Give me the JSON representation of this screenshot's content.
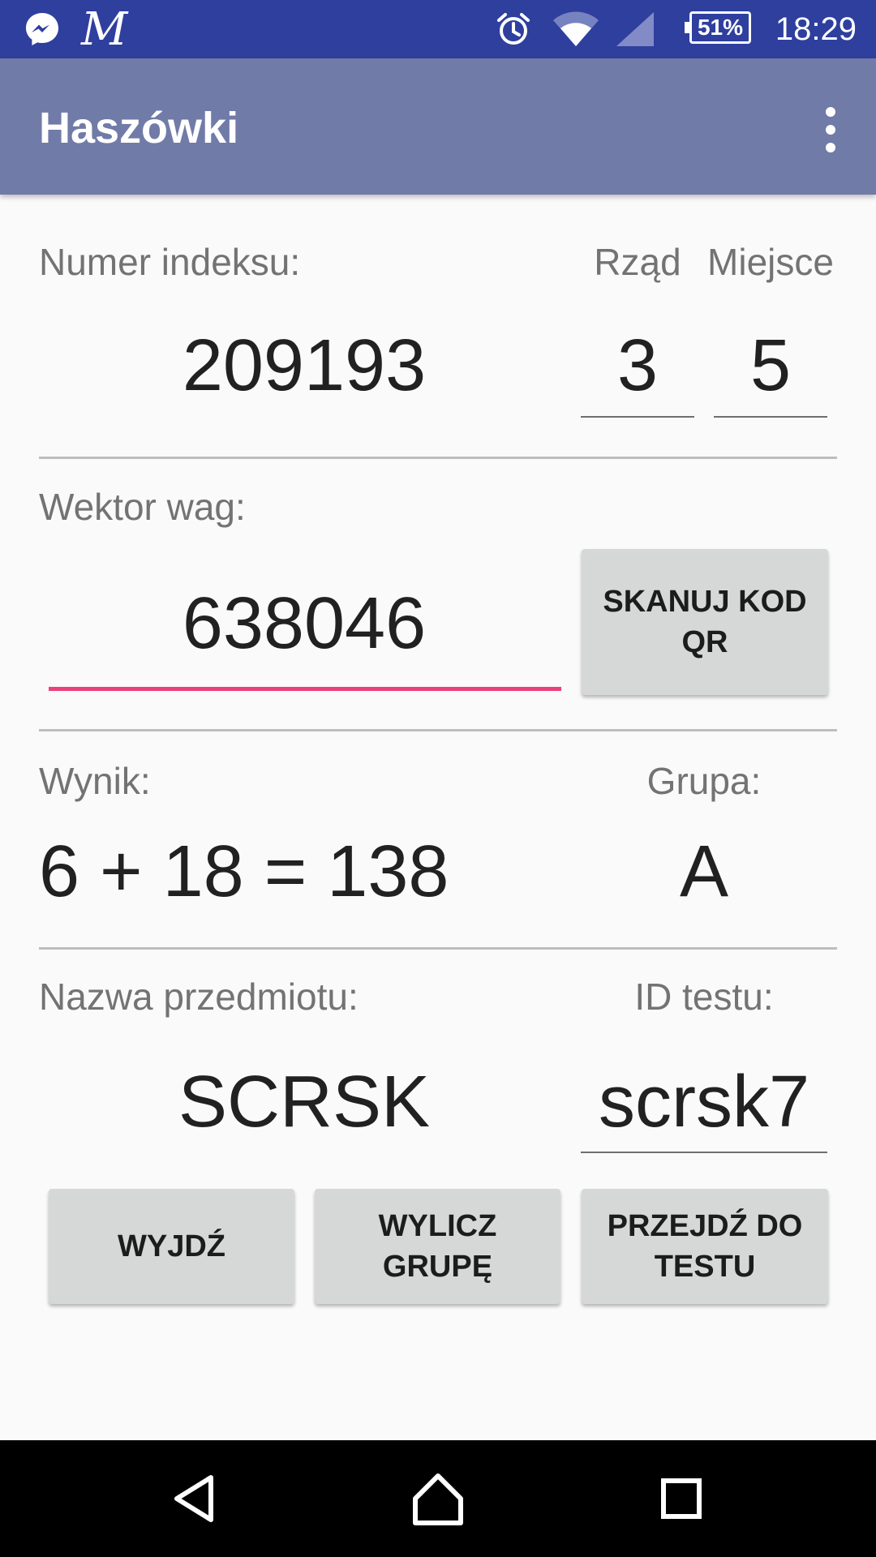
{
  "status_bar": {
    "time": "18:29",
    "battery": "51%",
    "app_icon_letter": "M",
    "icons": [
      "messenger-icon",
      "alarm-icon",
      "wifi-icon",
      "signal-icon",
      "battery-icon"
    ]
  },
  "app_bar": {
    "title": "Haszówki",
    "overflow_icon": "more-vert-icon"
  },
  "student": {
    "index_label": "Numer indeksu:",
    "index_value": "209193",
    "row_label": "Rząd",
    "row_value": "3",
    "seat_label": "Miejsce",
    "seat_value": "5"
  },
  "weights": {
    "label": "Wektor wag:",
    "value": "638046",
    "scan_button": "SKANUJ KOD QR"
  },
  "result": {
    "label": "Wynik:",
    "value": "6 + 18 = 138",
    "group_label": "Grupa:",
    "group_value": "A"
  },
  "subject": {
    "label": "Nazwa przedmiotu:",
    "value": "SCRSK",
    "test_id_label": "ID testu:",
    "test_id_value": "scrsk7"
  },
  "buttons": {
    "exit": "WYJDŹ",
    "compute_group": "WYLICZ GRUPĘ",
    "go_to_test": "PRZEJDŹ DO TESTU"
  },
  "colors": {
    "status_bar": "#2f3f9e",
    "app_bar": "#717ba8",
    "accent": "#ec407a"
  }
}
